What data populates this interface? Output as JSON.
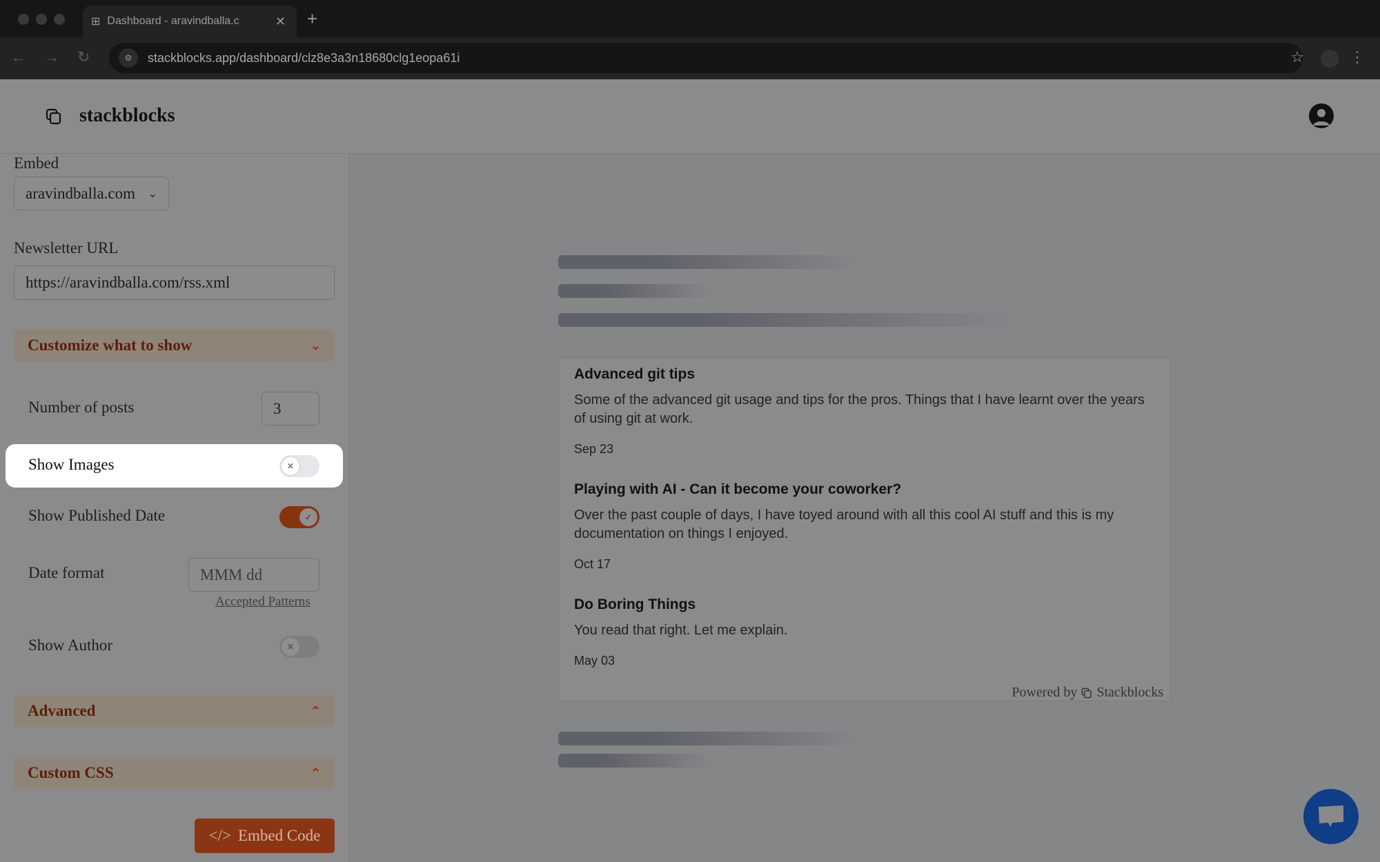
{
  "browser": {
    "tab_title": "Dashboard - aravindballa.c",
    "url": "stackblocks.app/dashboard/clz8e3a3n18680clg1eopa61i"
  },
  "header": {
    "brand": "stackblocks"
  },
  "sidebar": {
    "embed_label": "Embed",
    "embed_value": "aravindballa.com",
    "newsletter_label": "Newsletter URL",
    "newsletter_value": "https://aravindballa.com/rss.xml",
    "customize_label": "Customize what to show",
    "num_posts_label": "Number of posts",
    "num_posts_value": "3",
    "show_images_label": "Show Images",
    "show_images": false,
    "show_date_label": "Show Published Date",
    "show_date": true,
    "date_format_label": "Date format",
    "date_format_placeholder": "MMM dd",
    "accepted_patterns": "Accepted Patterns",
    "show_author_label": "Show Author",
    "show_author": false,
    "advanced_label": "Advanced",
    "custom_css_label": "Custom CSS",
    "embed_code_label": "Embed Code"
  },
  "preview": {
    "posts": [
      {
        "title": "Advanced git tips",
        "desc": "Some of the advanced git usage and tips for the pros. Things that I have learnt over the years of using git at work.",
        "date": "Sep 23"
      },
      {
        "title": "Playing with AI - Can it become your coworker?",
        "desc": "Over the past couple of days, I have toyed around with all this cool AI stuff and this is my documentation on things I enjoyed.",
        "date": "Oct 17"
      },
      {
        "title": "Do Boring Things",
        "desc": "You read that right. Let me explain.",
        "date": "May 03"
      }
    ],
    "powered_by": "Powered by",
    "powered_brand": "Stackblocks"
  },
  "colors": {
    "accent": "#c2410c",
    "chat": "#1d4ed8"
  }
}
